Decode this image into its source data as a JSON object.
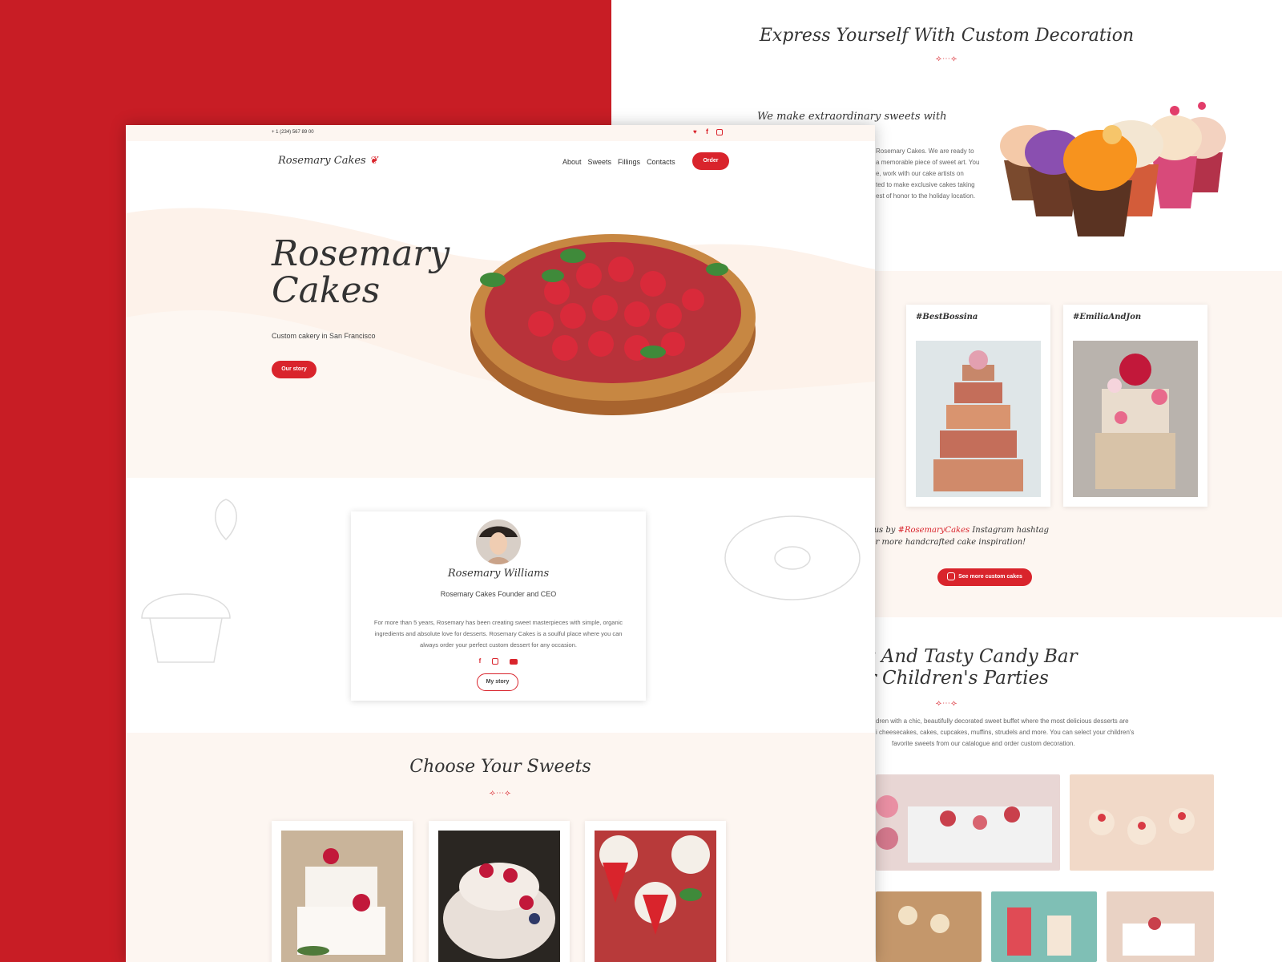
{
  "back": {
    "title": "Express Yourself With Custom Decoration",
    "divider": "⟢⋯⟣",
    "subtitle": "We make extraordinary sweets with",
    "paragraph_lines": [
      "Rosemary Cakes. We are ready to",
      "a memorable piece of sweet art. You",
      "e, work with our cake artists on",
      "ted to make exclusive cakes taking",
      "est of honor to the holiday location."
    ],
    "instagram": {
      "cards": [
        {
          "tag": "#BestBossina"
        },
        {
          "tag": "#EmiliaAndJon"
        }
      ],
      "follow_prefix": "Follow us by ",
      "follow_hashtag": "#RosemaryCakes",
      "follow_suffix": " Instagram hashtag",
      "follow_line2": "for more handcrafted cake inspiration!",
      "button_label": "See more custom cakes"
    },
    "candy": {
      "title_line1": "Bright And Tasty Candy Bar",
      "title_line2": "For Children's Parties",
      "paragraph_lines": [
        "dren with a chic, beautifully decorated sweet buffet where the most delicious desserts are",
        "i cheesecakes, cakes, cupcakes, muffins, strudels and more. You can select your children's",
        "favorite sweets from our catalogue and order custom decoration."
      ]
    }
  },
  "front": {
    "phone": "+ 1 (234) 567 89 00",
    "logo": "Rosemary Cakes",
    "menu": [
      "About",
      "Sweets",
      "Fillings",
      "Contacts"
    ],
    "order_label": "Order",
    "hero": {
      "title_line1": "Rosemary",
      "title_line2": "Cakes",
      "subtitle": "Custom cakery in San Francisco",
      "button_label": "Our story"
    },
    "founder": {
      "name": "Rosemary Williams",
      "role": "Rosemary Cakes Founder and CEO",
      "bio_lines": [
        "For more than 5 years, Rosemary has been creating sweet masterpieces with simple, organic",
        "ingredients and absolute love for desserts. Rosemary Cakes is a soulful place where you can",
        "always order your perfect custom dessert for any occasion."
      ],
      "button_label": "My story"
    },
    "sweets": {
      "title": "Choose Your Sweets"
    }
  },
  "colors": {
    "brand_red": "#c81d25",
    "accent_red": "#d9242c",
    "cream": "#fdf6f1"
  }
}
